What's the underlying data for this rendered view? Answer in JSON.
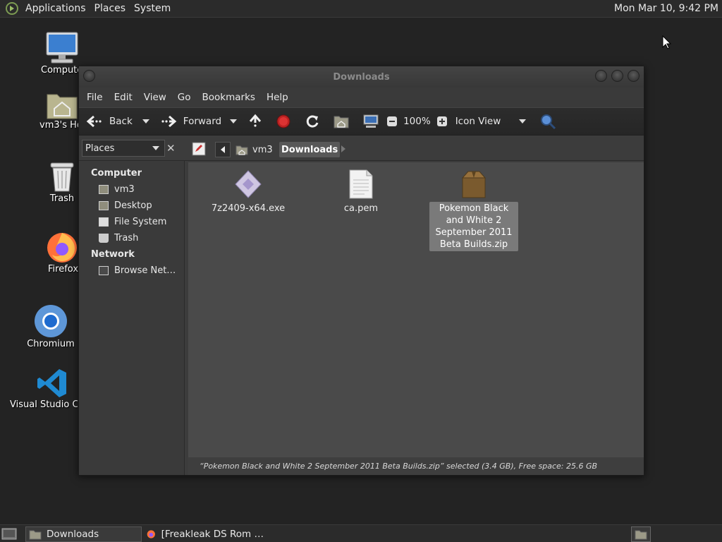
{
  "top_panel": {
    "menus": [
      "Applications",
      "Places",
      "System"
    ],
    "clock": "Mon Mar 10,  9:42 PM"
  },
  "desktop": {
    "icons": [
      {
        "label": "Computer"
      },
      {
        "label": "vm3's Home"
      },
      {
        "label": "Trash"
      },
      {
        "label": "Firefox"
      },
      {
        "label": "Chromium"
      },
      {
        "label": "Visual Studio Code"
      }
    ]
  },
  "window": {
    "title": "Downloads",
    "menubar": [
      "File",
      "Edit",
      "View",
      "Go",
      "Bookmarks",
      "Help"
    ],
    "toolbar": {
      "back_label": "Back",
      "forward_label": "Forward",
      "zoom": "100%",
      "view_mode": "Icon View"
    },
    "location": {
      "crumbs": [
        "vm3",
        "Downloads"
      ]
    },
    "sidebar": {
      "selector": "Places",
      "sections": [
        {
          "heading": "Computer",
          "items": [
            "vm3",
            "Desktop",
            "File System",
            "Trash"
          ]
        },
        {
          "heading": "Network",
          "items": [
            "Browse Net…"
          ]
        }
      ]
    },
    "files": [
      {
        "name": "7z2409-x64.exe",
        "icon": "exe-file-icon"
      },
      {
        "name": "ca.pem",
        "icon": "text-file-icon"
      },
      {
        "name": "Pokemon Black and White 2 September 2011 Beta Builds.zip",
        "icon": "archive-icon",
        "selected": true
      }
    ],
    "status": "“Pokemon Black and White 2 September 2011 Beta Builds.zip” selected (3.4 GB), Free space: 25.6 GB"
  },
  "taskbar": {
    "tasks": [
      "Downloads",
      "[Freakleak DS Rom …"
    ]
  }
}
